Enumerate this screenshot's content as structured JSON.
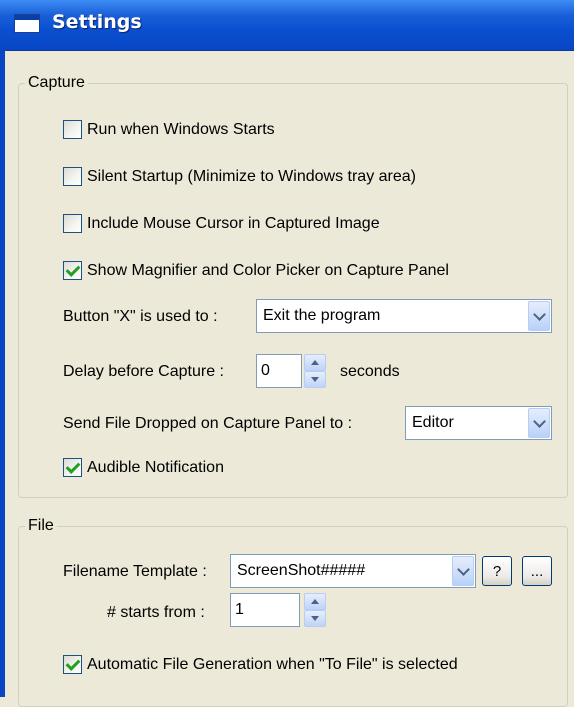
{
  "window": {
    "title": "Settings"
  },
  "capture": {
    "legend": "Capture",
    "run_on_startup": {
      "label": "Run when Windows Starts",
      "checked": false
    },
    "silent_startup": {
      "label": "Silent Startup (Minimize to Windows tray area)",
      "checked": false
    },
    "include_cursor": {
      "label": "Include Mouse Cursor in Captured Image",
      "checked": false
    },
    "show_magnifier": {
      "label": "Show Magnifier and Color Picker on Capture Panel",
      "checked": true
    },
    "button_x": {
      "label": "Button \"X\" is used to :",
      "value": "Exit the program"
    },
    "delay": {
      "label": "Delay before Capture :",
      "value": "0",
      "unit": "seconds"
    },
    "send_file": {
      "label": "Send File Dropped on Capture Panel to :",
      "value": "Editor"
    },
    "audible": {
      "label": "Audible Notification",
      "checked": true
    }
  },
  "file": {
    "legend": "File",
    "template": {
      "label": "Filename Template :",
      "value": "ScreenShot#####",
      "help_label": "?",
      "browse_label": "..."
    },
    "starts_from": {
      "label": "# starts from :",
      "value": "1"
    },
    "auto_generation": {
      "label": "Automatic File Generation when \"To File\" is selected",
      "checked": true
    }
  },
  "colors": {
    "titlebar": "#0a4fd0",
    "dialog_bg": "#ece9d8",
    "checkmark": "#21a121",
    "field_border": "#7f9db9"
  }
}
